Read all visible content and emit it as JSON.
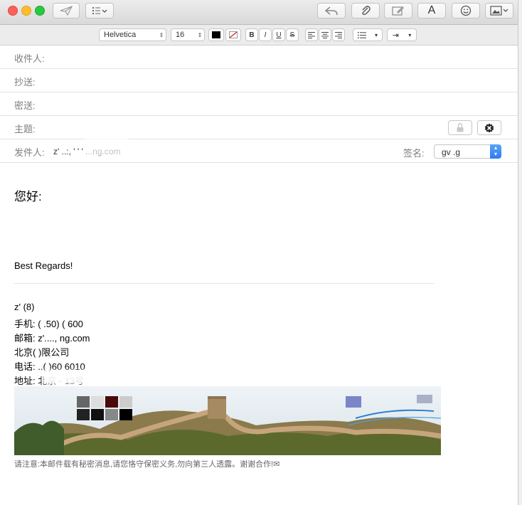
{
  "toolbar": {
    "send_icon": "paper-plane-icon",
    "list_icon": "list-icon",
    "reply_icon": "reply-arrow-icon",
    "attach_icon": "paperclip-icon",
    "markup_icon": "markup-icon",
    "font_button": "A",
    "emoji_icon": "smiley-icon",
    "photo_icon": "photo-icon"
  },
  "format": {
    "font": "Helvetica",
    "size": "16",
    "bold": "B",
    "italic": "I",
    "underline": "U",
    "strike": "S"
  },
  "fields": {
    "to_label": "收件人:",
    "cc_label": "抄送:",
    "bcc_label": "密送:",
    "subject_label": "主题:",
    "from_label": "发件人:",
    "from_value": "z' ..:, '   '  ' ...ng.com",
    "signature_label": "签名:",
    "signature_value": "gv     .g"
  },
  "body": {
    "greeting": "您好:",
    "regards": "Best Regards!",
    "sig_line_1": "z'    (8)",
    "sig_line_2": "手机: ( .50) (       600",
    "sig_line_3": "邮箱: z'....,         ng.com",
    "sig_line_4": "北京(        )限公司",
    "sig_line_5": "电话:  ..(          )60 6010",
    "sig_line_6": "地址: 北京         -            13号",
    "notice": "请注意:本邮件载有秘密消息,请您恪守保密义务,勿向第三人透露。谢谢合作!✉"
  },
  "colors": {
    "accent_blue": "#2a7ef0",
    "close": "#fe5f57",
    "minimize": "#febc2e",
    "zoom": "#28c840"
  }
}
